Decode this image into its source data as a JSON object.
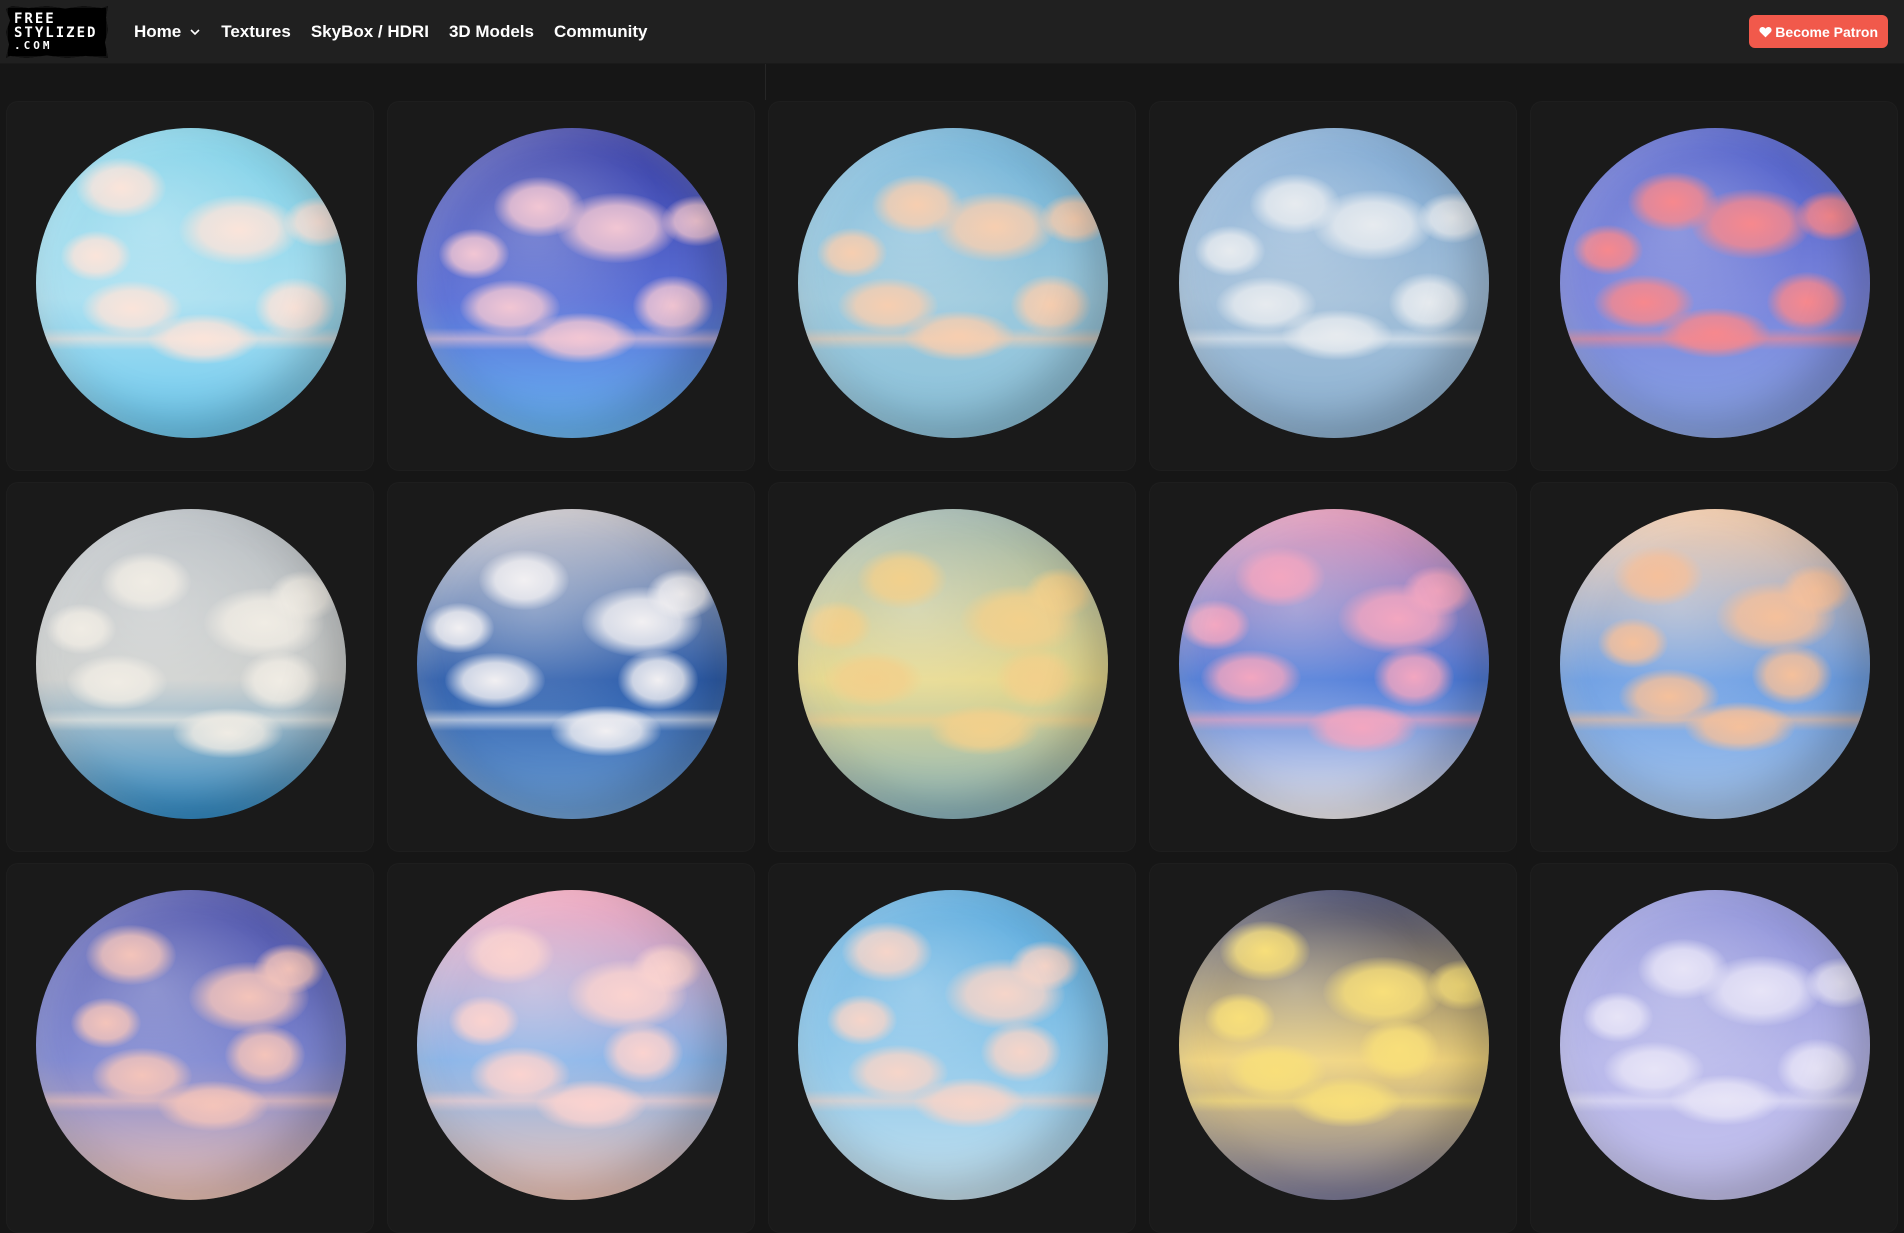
{
  "site": {
    "logo_lines": [
      "FREE",
      "STYLIZED",
      ".COM"
    ]
  },
  "nav": {
    "items": [
      {
        "label": "Home",
        "has_dropdown": true
      },
      {
        "label": "Textures"
      },
      {
        "label": "SkyBox / HDRI"
      },
      {
        "label": "3D Models"
      },
      {
        "label": "Community"
      }
    ]
  },
  "header": {
    "patron_label": "Become Patron",
    "patron_color": "#f1594b"
  },
  "icons": {
    "nav_dropdown": "chevron-down-icon",
    "patron": "heart-icon"
  },
  "grid": {
    "columns": 5,
    "items": [
      {
        "name": "skybox-1",
        "top": "#7fd1e8",
        "mid": "#a9dff0",
        "bottom": "#6cc9f0",
        "cloud": "#fbe4da"
      },
      {
        "name": "skybox-2",
        "top": "#3a3fa6",
        "mid": "#5a6fd6",
        "bottom": "#6ab9f7",
        "cloud": "#f2c6d3"
      },
      {
        "name": "skybox-3",
        "top": "#6fb2d8",
        "mid": "#9cc9dd",
        "bottom": "#8cc3dc",
        "cloud": "#f7ceb0"
      },
      {
        "name": "skybox-4",
        "top": "#7ea9d4",
        "mid": "#a2bfd9",
        "bottom": "#8fb4d4",
        "cloud": "#e7ebef"
      },
      {
        "name": "skybox-5",
        "top": "#4d5cc8",
        "mid": "#7a85dc",
        "bottom": "#8aa5e6",
        "cloud": "#f7888d"
      },
      {
        "name": "skybox-6",
        "top": "#b9bfc4",
        "mid": "#cfd1cf",
        "bottom": "#2f8bc7",
        "cloud": "#f0ece4"
      },
      {
        "name": "skybox-7",
        "top": "#c8c4c9",
        "mid": "#2f5fad",
        "bottom": "#6ea2d9",
        "cloud": "#f2f0f2"
      },
      {
        "name": "skybox-8",
        "top": "#9fb6ad",
        "mid": "#e7d98d",
        "bottom": "#8bb6bf",
        "cloud": "#f2d08c"
      },
      {
        "name": "skybox-9",
        "top": "#e494b5",
        "mid": "#4e7bd8",
        "bottom": "#f4f0f3",
        "cloud": "#f3a6c0"
      },
      {
        "name": "skybox-10",
        "top": "#f4c8a4",
        "mid": "#6e9fe3",
        "bottom": "#a9c8ee",
        "cloud": "#f5c09b"
      },
      {
        "name": "skybox-11",
        "top": "#4a4fa8",
        "mid": "#7d86d0",
        "bottom": "#f1c6b8",
        "cloud": "#f4c4ba"
      },
      {
        "name": "skybox-12",
        "top": "#f4a5bd",
        "mid": "#8ab4e8",
        "bottom": "#f1c6b8",
        "cloud": "#fbd3cf"
      },
      {
        "name": "skybox-13",
        "top": "#58a9dd",
        "mid": "#8fc8ea",
        "bottom": "#c8e3f0",
        "cloud": "#f6d5c9"
      },
      {
        "name": "skybox-14",
        "top": "#3a3e63",
        "mid": "#f0d37c",
        "bottom": "#7d7b9b",
        "cloud": "#f8df7a"
      },
      {
        "name": "skybox-15",
        "top": "#8b8fd8",
        "mid": "#b7b7ea",
        "bottom": "#c6c3ef",
        "cloud": "#e7e4f7"
      }
    ]
  }
}
